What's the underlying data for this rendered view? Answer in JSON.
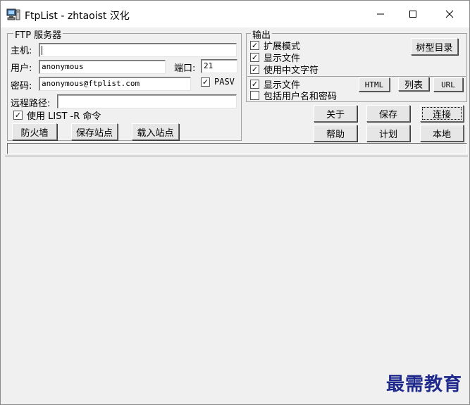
{
  "window": {
    "title": "FtpList - zhtaoist 汉化",
    "minimize_glyph": "—",
    "maximize_glyph": "☐",
    "close_glyph": "✕"
  },
  "server": {
    "group_title": "FTP 服务器",
    "host_label": "主机:",
    "host_value": "",
    "user_label": "用户:",
    "user_value": "anonymous",
    "port_label": "端口:",
    "port_value": "21",
    "password_label": "密码:",
    "password_value": "anonymous@ftplist.com",
    "pasv_label": "PASV",
    "pasv_checked": true,
    "remote_path_label": "远程路径:",
    "remote_path_value": "",
    "list_r_label": "使用 LIST -R 命令",
    "list_r_checked": true,
    "firewall_button": "防火墙",
    "save_site_button": "保存站点",
    "load_site_button": "载入站点"
  },
  "output": {
    "group_title": "输出",
    "expand_mode_label": "扩展模式",
    "show_files_label": "显示文件",
    "chinese_chars_label": "使用中文字符",
    "tree_button": "树型目录",
    "show_files2_label": "显示文件",
    "include_user_label": "包括用户名和密码",
    "html_button": "HTML",
    "list_button": "列表",
    "url_button": "URL",
    "check_mark": "✓"
  },
  "actions": {
    "about": "关于",
    "save": "保存",
    "connect": "连接",
    "help": "帮助",
    "schedule": "计划",
    "local": "本地"
  },
  "watermark": "最需教育"
}
